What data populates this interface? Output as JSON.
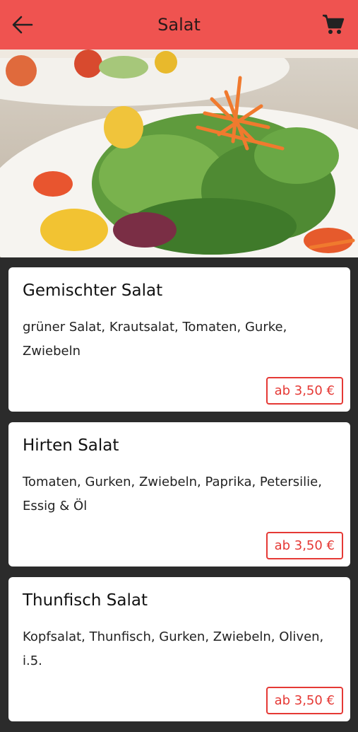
{
  "header": {
    "title": "Salat",
    "back_icon": "arrow-left-icon",
    "cart_icon": "shopping-cart-icon",
    "bar_color": "#ef5350"
  },
  "hero": {
    "image": "salad-photo"
  },
  "items": [
    {
      "name": "Gemischter Salat",
      "description": "grüner Salat, Krautsalat, Tomaten, Gurke, Zwiebeln",
      "price": "ab 3,50 €"
    },
    {
      "name": "Hirten Salat",
      "description": "Tomaten, Gurken, Zwiebeln, Paprika, Petersilie, Essig & Öl",
      "price": "ab 3,50 €"
    },
    {
      "name": "Thunfisch Salat",
      "description": "Kopfsalat, Thunfisch, Gurken, Zwiebeln, Oliven, i.5.",
      "price": "ab 3,50 €"
    }
  ],
  "accent_color": "#e53935"
}
